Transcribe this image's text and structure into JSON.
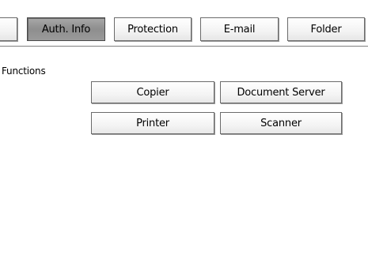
{
  "tabs": {
    "auth_info": "Auth. Info",
    "protection": "Protection",
    "email": "E-mail",
    "folder": "Folder"
  },
  "functions": {
    "label": "Functions",
    "buttons": {
      "copier": "Copier",
      "document_server": "Document Server",
      "printer": "Printer",
      "scanner": "Scanner"
    }
  }
}
